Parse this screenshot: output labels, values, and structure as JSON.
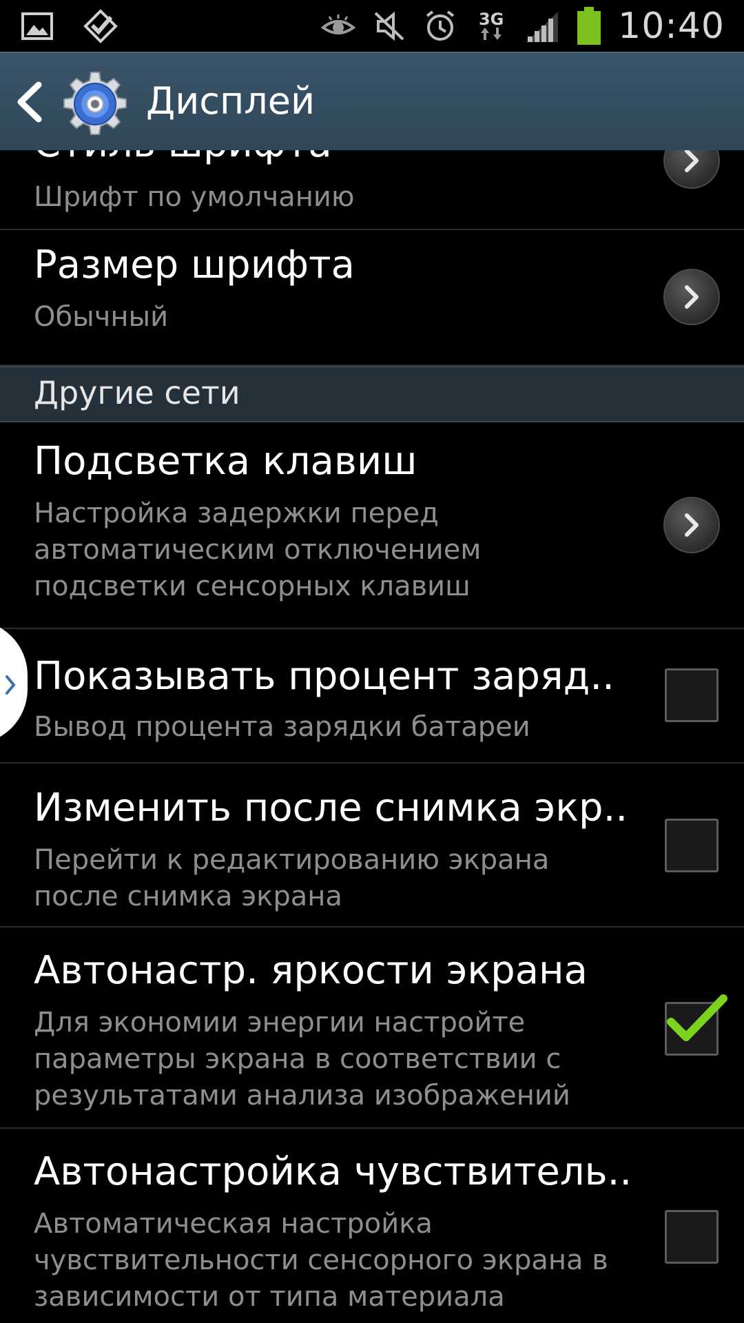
{
  "status_bar": {
    "time": "10:40",
    "network": "3G",
    "left_icons": [
      "image-icon",
      "task-check-icon"
    ],
    "right_icons": [
      "smart-stay-eye-icon",
      "mute-icon",
      "alarm-icon",
      "network-3g-icon",
      "signal-icon",
      "battery-icon"
    ],
    "battery_color": "#7cc21e"
  },
  "header": {
    "title": "Дисплей"
  },
  "rows": [
    {
      "title": "Стиль шрифта",
      "subtitle": "Шрифт по умолчанию",
      "control": "chevron"
    },
    {
      "title": "Размер шрифта",
      "subtitle": "Обычный",
      "control": "chevron"
    },
    {
      "title": "Подсветка клавиш",
      "subtitle": "Настройка задержки перед автоматическим отключением подсветки сенсорных клавиш",
      "control": "chevron"
    },
    {
      "title": "Показывать процент заряд..",
      "subtitle": "Вывод процента зарядки батареи",
      "control": "checkbox",
      "checked": false
    },
    {
      "title": "Изменить после снимка экр..",
      "subtitle": "Перейти к редактированию экрана после снимка экрана",
      "control": "checkbox",
      "checked": false
    },
    {
      "title": "Автонастр. яркости экрана",
      "subtitle": "Для экономии энергии настройте параметры экрана в соответствии с результатами анализа изображений",
      "control": "checkbox",
      "checked": true
    },
    {
      "title": "Автонастройка чувствитель..",
      "subtitle": "Автоматическая настройка чувствительности сенсорного экрана в зависимости от типа материала",
      "control": "checkbox",
      "checked": false
    }
  ],
  "section": {
    "label": "Другие сети"
  },
  "colors": {
    "action_bar": "#2f4759",
    "section_bg": "#25313a",
    "check_green": "#7cd21e",
    "subtitle": "#8e8e8e"
  }
}
